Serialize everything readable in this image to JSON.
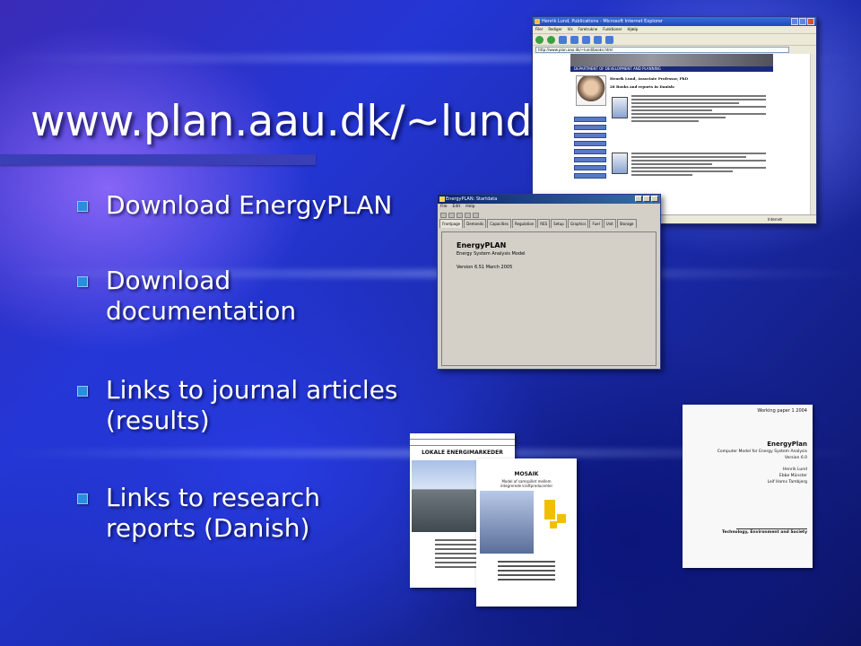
{
  "slide": {
    "title": "www.plan.aau.dk/~lund",
    "bullets": [
      {
        "line1": "Download EnergyPLAN",
        "line2": ""
      },
      {
        "line1": "Download",
        "line2": "documentation"
      },
      {
        "line1": "Links to journal articles",
        "line2": "(results)"
      },
      {
        "line1": "Links to research",
        "line2": "reports (Danish)"
      }
    ]
  },
  "browser": {
    "window_title": "Henrik Lund, Publications - Microsoft Internet Explorer",
    "menu": [
      "Filer",
      "Rediger",
      "Vis",
      "Foretrukne",
      "Funktioner",
      "Hjælp"
    ],
    "address": "http://www.plan.aau.dk/~lund/books.html",
    "department": "DEPARTMENT OF DEVELOPMENT AND PLANNING",
    "person": "Henrik Lund, Associate Professor, PhD",
    "books_heading": "28 Books and reports in Danish:",
    "status": "Internet"
  },
  "energyplan": {
    "window_title": "EnergyPLAN: Startdata",
    "menu": [
      "File",
      "Edit",
      "Help"
    ],
    "tabs": [
      "Frontpage",
      "Demands",
      "Capacities",
      "Regulation",
      "RES",
      "Setup",
      "Graphics",
      "Fuel",
      "Unit",
      "Storage"
    ],
    "name": "EnergyPLAN",
    "subtitle": "Energy System Analysis Model",
    "version": "Version 6.51 March 2005"
  },
  "covers": {
    "cover1_title": "LOKALE ENERGIMARKEDER",
    "cover2_title": "MOSAIK",
    "cover2_sub1": "Model af samspillet mellem",
    "cover2_sub2": "integrerede kraftproducenter",
    "cover3": {
      "series": "Working paper 1 2004",
      "title": "EnergyPlan",
      "subtitle": "Computer Model for Energy System Analysis",
      "version": "Version 6.0",
      "author1": "Henrik Lund",
      "author2": "Ebbe Münster",
      "author3": "Leif Hams Tambjerg",
      "footer": "Technology, Environment and Society"
    }
  },
  "colors": {
    "bullet": "#2a8ee0",
    "rule": "#3a3fb8"
  }
}
